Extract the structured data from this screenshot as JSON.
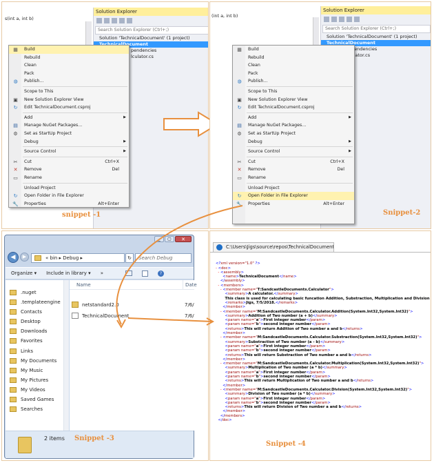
{
  "snippet1": {
    "caption": "snippet -1",
    "code_text": "s(int a, int b)",
    "solution_explorer": {
      "title": "Solution Explorer",
      "search_placeholder": "Search Solution Explorer (Ctrl+;)",
      "lines": [
        "Solution 'TechnicalDocument' (1 project)",
        "TechnicalDocument",
        "pendencies",
        "lculator.cs"
      ]
    },
    "menu": [
      {
        "label": "Build",
        "icon": "build-icon",
        "highlight": true
      },
      {
        "label": "Rebuild"
      },
      {
        "label": "Clean"
      },
      {
        "label": "Pack"
      },
      {
        "label": "Publish...",
        "icon": "globe-icon"
      },
      {
        "sep": true
      },
      {
        "label": "Scope to This"
      },
      {
        "label": "New Solution Explorer View",
        "icon": "window-icon"
      },
      {
        "label": "Edit TechnicalDocument.csproj",
        "icon": "refresh-icon"
      },
      {
        "sep": true
      },
      {
        "label": "Add",
        "arrow": true
      },
      {
        "label": "Manage NuGet Packages...",
        "icon": "nuget-icon"
      },
      {
        "label": "Set as StartUp Project",
        "icon": "gear-icon"
      },
      {
        "label": "Debug",
        "arrow": true
      },
      {
        "sep": true
      },
      {
        "label": "Source Control",
        "arrow": true
      },
      {
        "sep": true
      },
      {
        "label": "Cut",
        "icon": "scissors-icon",
        "shortcut": "Ctrl+X"
      },
      {
        "label": "Remove",
        "icon": "remove-icon",
        "shortcut": "Del"
      },
      {
        "label": "Rename",
        "icon": "rename-icon"
      },
      {
        "sep": true
      },
      {
        "label": "Unload Project"
      },
      {
        "label": "Open Folder in File Explorer",
        "icon": "refresh-icon"
      },
      {
        "label": "Properties",
        "icon": "wrench-icon",
        "shortcut": "Alt+Enter"
      }
    ]
  },
  "snippet2": {
    "caption": "Snippet-2",
    "code_text": "(int a, int b)",
    "solution_explorer": {
      "title": "Solution Explorer",
      "search_placeholder": "Search Solution Explorer (Ctrl+;)",
      "lines": [
        "Solution 'TechnicalDocument' (1 project)",
        "TechnicalDocument",
        "ependencies",
        "culator.cs"
      ]
    },
    "menu": [
      {
        "label": "Build",
        "icon": "build-icon"
      },
      {
        "label": "Rebuild"
      },
      {
        "label": "Clean"
      },
      {
        "label": "Pack"
      },
      {
        "label": "Publish...",
        "icon": "globe-icon"
      },
      {
        "sep": true
      },
      {
        "label": "Scope to This"
      },
      {
        "label": "New Solution Explorer View",
        "icon": "window-icon"
      },
      {
        "label": "Edit TechnicalDocument.csproj",
        "icon": "refresh-icon"
      },
      {
        "sep": true
      },
      {
        "label": "Add",
        "arrow": true
      },
      {
        "label": "Manage NuGet Packages...",
        "icon": "nuget-icon"
      },
      {
        "label": "Set as StartUp Project",
        "icon": "gear-icon"
      },
      {
        "label": "Debug",
        "arrow": true
      },
      {
        "sep": true
      },
      {
        "label": "Source Control",
        "arrow": true
      },
      {
        "sep": true
      },
      {
        "label": "Cut",
        "icon": "scissors-icon",
        "shortcut": "Ctrl+X"
      },
      {
        "label": "Remove",
        "icon": "remove-icon",
        "shortcut": "Del"
      },
      {
        "label": "Rename",
        "icon": "rename-icon"
      },
      {
        "sep": true
      },
      {
        "label": "Unload Project"
      },
      {
        "label": "Open Folder in File Explorer",
        "icon": "refresh-icon",
        "highlight": true
      },
      {
        "label": "Properties",
        "icon": "wrench-icon",
        "shortcut": "Alt+Enter"
      }
    ]
  },
  "snippet3": {
    "caption": "Snippet -3",
    "address": "« bin ▸ Debug ▸",
    "search_placeholder": "Search Debug",
    "toolbar": {
      "organize": "Organize ▾",
      "include": "Include in library ▾",
      "more": "»"
    },
    "nav_items": [
      ".nuget",
      ".templateengine",
      "Contacts",
      "Desktop",
      "Downloads",
      "Favorites",
      "Links",
      "My Documents",
      "My Music",
      "My Pictures",
      "My Videos",
      "Saved Games",
      "Searches"
    ],
    "columns": {
      "name": "Name",
      "date": "Date"
    },
    "files": [
      {
        "name": "netstandard2.0",
        "date": "7/6/"
      },
      {
        "name": "TechnicalDocument",
        "date": "7/6/"
      }
    ],
    "status": "2 items"
  },
  "snippet4": {
    "caption": "Snippet -4",
    "tab_title": "C:\\Users\\Jigs\\source\\repos\\TechnicalDocument\\..."
  },
  "colors": {
    "accent": "#e8903e",
    "selection": "#3399ff",
    "highlight": "#fff2b0"
  }
}
